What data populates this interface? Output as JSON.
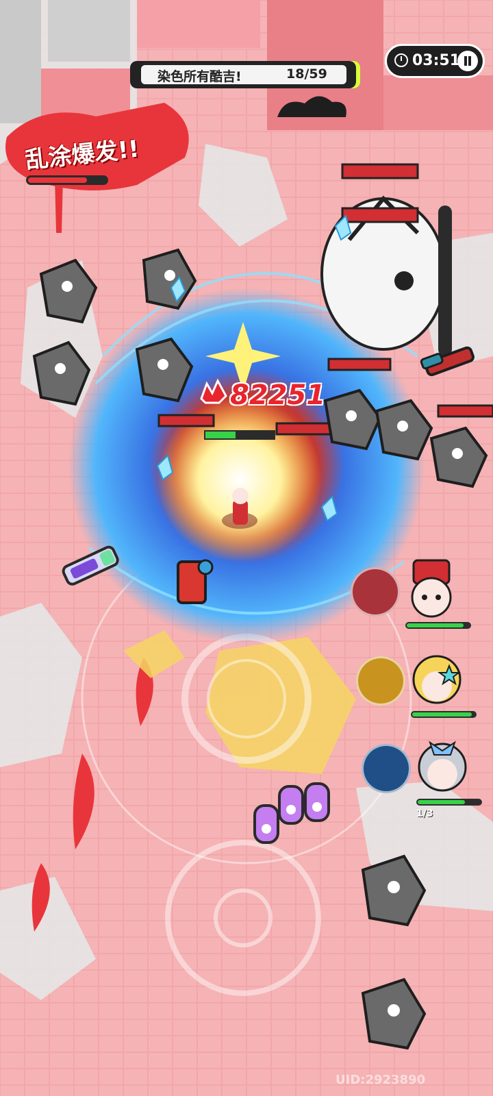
{
  "objective": {
    "text": "染色所有酷吉!",
    "progress": "18/59",
    "colors": {
      "bar": "#232323",
      "accent": "#d8ff3a"
    }
  },
  "timer": {
    "time": "03:51",
    "pause_icon": "pause-icon"
  },
  "skill": {
    "label": "乱涂爆发!!",
    "charge_fraction": 0.75
  },
  "combat": {
    "damage": "82251"
  },
  "team": [
    {
      "name": "hat-hero",
      "hp_fraction": 0.9,
      "skill_color": "#a8333b"
    },
    {
      "name": "star-hero",
      "hp_fraction": 0.95,
      "skill_color": "#c99320"
    },
    {
      "name": "silver-hero",
      "hp_fraction": 0.75,
      "skill_color": "#1f4f86",
      "charges": "1/3"
    }
  ],
  "footer": {
    "uid": "UID:2923890"
  },
  "colors": {
    "paint_red": "#e8353b",
    "paint_pink": "#f0a3a6",
    "arena_blue": "#2a6fe0",
    "ground_gray": "#d9d9d9"
  }
}
